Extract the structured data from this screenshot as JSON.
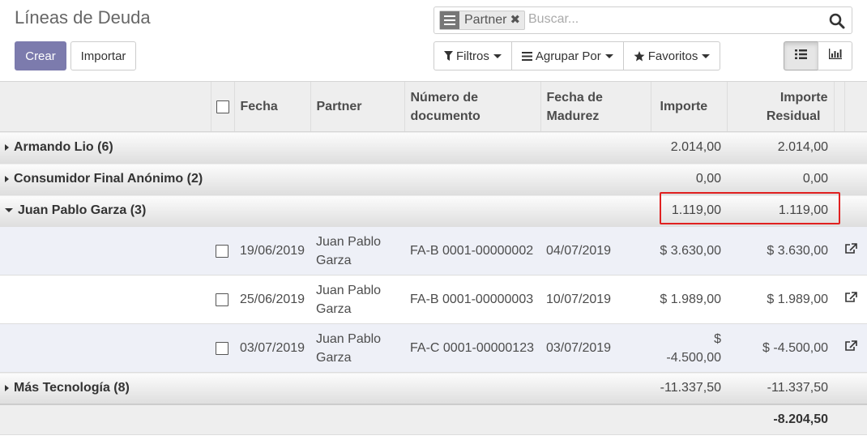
{
  "page": {
    "title": "Líneas de Deuda"
  },
  "search": {
    "facet_value": "Partner",
    "placeholder": "Buscar..."
  },
  "buttons": {
    "create": "Crear",
    "import": "Importar"
  },
  "filters": {
    "filters": "Filtros",
    "group_by": "Agrupar Por",
    "favorites": "Favoritos"
  },
  "views": [
    "list-icon",
    "chart-icon"
  ],
  "columns": {
    "date": "Fecha",
    "partner": "Partner",
    "doc_line1": "Número de",
    "doc_line2": "documento",
    "mat_line1": "Fecha de",
    "mat_line2": "Madurez",
    "amount": "Importe",
    "res_line1": "Importe",
    "res_line2": "Residual"
  },
  "groups": [
    {
      "name": "Armando Lio (6)",
      "amount": "2.014,00",
      "residual": "2.014,00",
      "expanded": false
    },
    {
      "name": "Consumidor Final Anónimo (2)",
      "amount": "0,00",
      "residual": "0,00",
      "expanded": false
    },
    {
      "name": "Juan Pablo Garza (3)",
      "amount": "1.119,00",
      "residual": "1.119,00",
      "expanded": true
    },
    {
      "name": "Más Tecnología (8)",
      "amount": "-11.337,50",
      "residual": "-11.337,50",
      "expanded": false
    }
  ],
  "records": [
    {
      "date": "19/06/2019",
      "partner_l1": "Juan Pablo",
      "partner_l2": "Garza",
      "document": "FA-B 0001-00000002",
      "maturity": "04/07/2019",
      "amount": "$ 3.630,00",
      "residual": "$ 3.630,00"
    },
    {
      "date": "25/06/2019",
      "partner_l1": "Juan Pablo",
      "partner_l2": "Garza",
      "document": "FA-B 0001-00000003",
      "maturity": "10/07/2019",
      "amount": "$ 1.989,00",
      "residual": "$ 1.989,00"
    },
    {
      "date": "03/07/2019",
      "partner_l1": "Juan Pablo",
      "partner_l2": "Garza",
      "document": "FA-C 0001-00000123",
      "maturity": "03/07/2019",
      "amount": "$ -4.500,00",
      "residual": "$ -4.500,00"
    }
  ],
  "totals": {
    "residual": "-8.204,50"
  },
  "colors": {
    "primary": "#7c7bad",
    "highlight": "#e02020",
    "row_alt": "#eef0f7"
  }
}
